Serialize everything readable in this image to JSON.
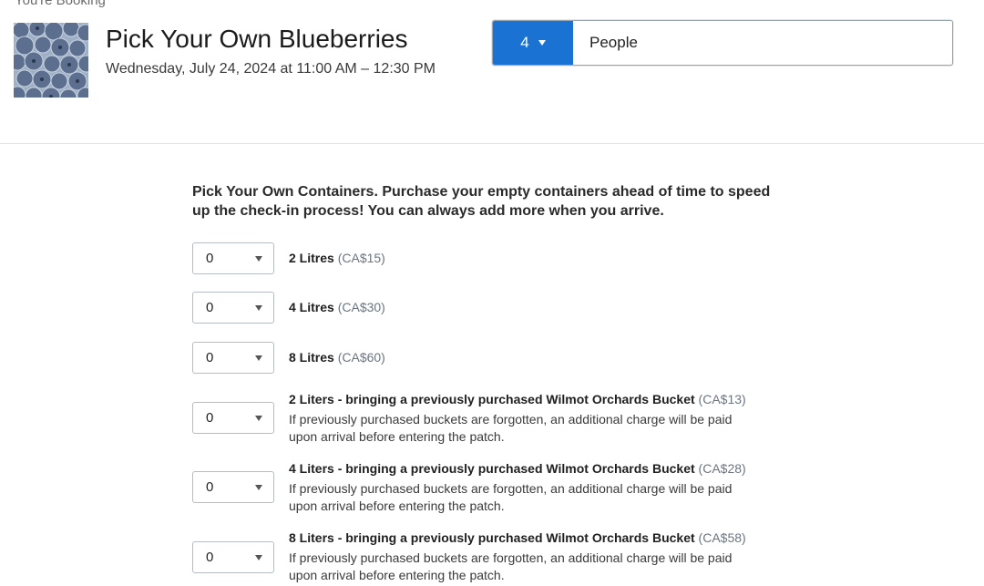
{
  "header": {
    "top_label": "You're Booking",
    "event_title": "Pick Your Own Blueberries",
    "event_date": "Wednesday, July 24, 2024 at 11:00 AM – 12:30 PM"
  },
  "party": {
    "count": "4",
    "label": "People"
  },
  "section": {
    "heading": "Pick Your Own Containers. Purchase your empty containers ahead of time to speed up the check-in process! You can always add more when you arrive."
  },
  "options": [
    {
      "qty": "0",
      "name": "2 Litres",
      "price": "(CA$15)",
      "note": ""
    },
    {
      "qty": "0",
      "name": "4 Litres",
      "price": "(CA$30)",
      "note": ""
    },
    {
      "qty": "0",
      "name": "8 Litres",
      "price": "(CA$60)",
      "note": ""
    },
    {
      "qty": "0",
      "name": "2 Liters - bringing a previously purchased Wilmot Orchards Bucket",
      "price": "(CA$13)",
      "note": "If previously purchased buckets are forgotten, an additional charge will be paid upon arrival before entering the patch."
    },
    {
      "qty": "0",
      "name": "4 Liters - bringing a previously purchased Wilmot Orchards Bucket",
      "price": "(CA$28)",
      "note": "If previously purchased buckets are forgotten, an additional charge will be paid upon arrival before entering the patch."
    },
    {
      "qty": "0",
      "name": "8 Liters - bringing a previously purchased Wilmot Orchards Bucket",
      "price": "(CA$58)",
      "note": "If previously purchased buckets are forgotten, an additional charge will be paid upon arrival before entering the patch."
    }
  ],
  "colors": {
    "accent": "#1a73d2",
    "price": "#6b7580"
  }
}
